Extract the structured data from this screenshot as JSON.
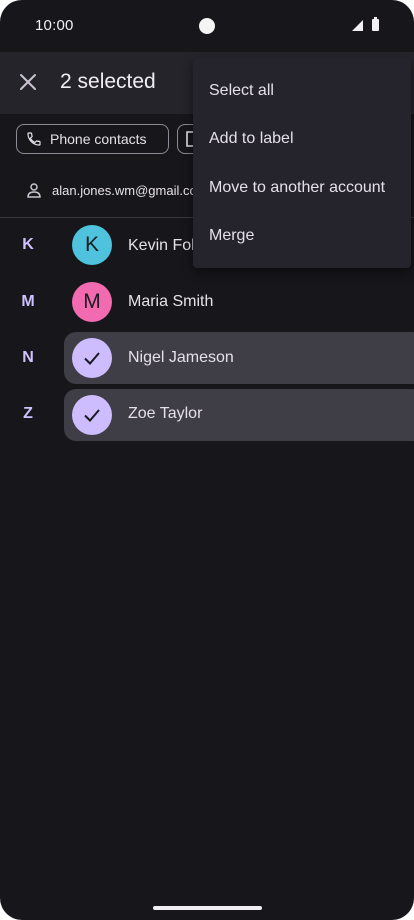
{
  "status_bar": {
    "time": "10:00"
  },
  "app_bar": {
    "title": "2 selected",
    "close_icon": "close-icon"
  },
  "chips": [
    {
      "label": "Phone contacts",
      "icon": "phone-icon"
    },
    {
      "label": "",
      "icon": "sim-card-icon"
    }
  ],
  "account": {
    "email": "alan.jones.wm@gmail.com",
    "icon": "person-icon"
  },
  "contacts": [
    {
      "section": "K",
      "initial": "K",
      "name": "Kevin Foley",
      "avatar_color": "#4fc3dd",
      "selected": false
    },
    {
      "section": "M",
      "initial": "M",
      "name": "Maria Smith",
      "avatar_color": "#f26bb0",
      "selected": false
    },
    {
      "section": "N",
      "initial": "",
      "name": "Nigel Jameson",
      "avatar_color": "#cdbdff",
      "selected": true
    },
    {
      "section": "Z",
      "initial": "",
      "name": "Zoe Taylor",
      "avatar_color": "#cdbdff",
      "selected": true
    }
  ],
  "menu": {
    "items": [
      {
        "label": "Select all"
      },
      {
        "label": "Add to label"
      },
      {
        "label": "Move to another account"
      },
      {
        "label": "Merge"
      }
    ]
  },
  "colors": {
    "background": "#17161b",
    "app_bar": "#25242b",
    "accent_letter": "#cfc2ff",
    "selected_row": "#3f3d46"
  }
}
